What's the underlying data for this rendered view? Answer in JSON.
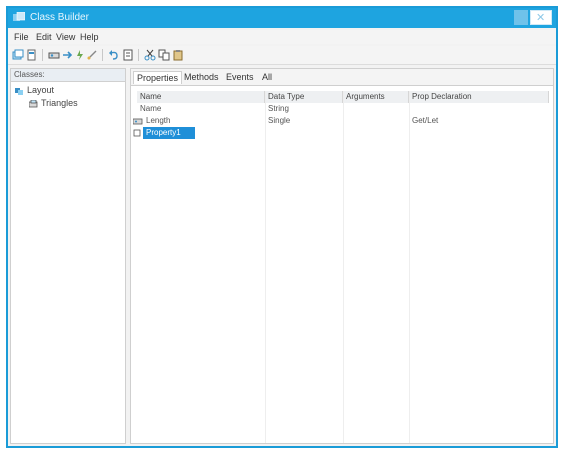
{
  "window": {
    "title": "Class Builder"
  },
  "menu": [
    "File",
    "Edit",
    "View",
    "Help"
  ],
  "toolbar_icons": [
    "new-class-icon",
    "new-collection-icon",
    "add-property-icon",
    "add-method-icon",
    "add-event-icon",
    "add-enum-icon",
    "undo-icon",
    "properties-icon",
    "cut-icon",
    "copy-icon",
    "paste-icon"
  ],
  "left_panel": {
    "header": "Classes:",
    "root": "Layout",
    "child": "Triangles"
  },
  "tabs": [
    "Properties",
    "Methods",
    "Events",
    "All"
  ],
  "table": {
    "columns": [
      "Name",
      "Data Type",
      "Arguments",
      "Prop Declaration"
    ],
    "rows": [
      {
        "name": "Name",
        "type": "String",
        "args": "",
        "decl": ""
      },
      {
        "name": "Length",
        "type": "Single",
        "args": "",
        "decl": "Get/Let"
      }
    ],
    "editing_value": "Property1"
  },
  "colors": {
    "titlebar": "#1ea4e0",
    "selection": "#1f8fd8",
    "border": "#1a9bd7"
  }
}
